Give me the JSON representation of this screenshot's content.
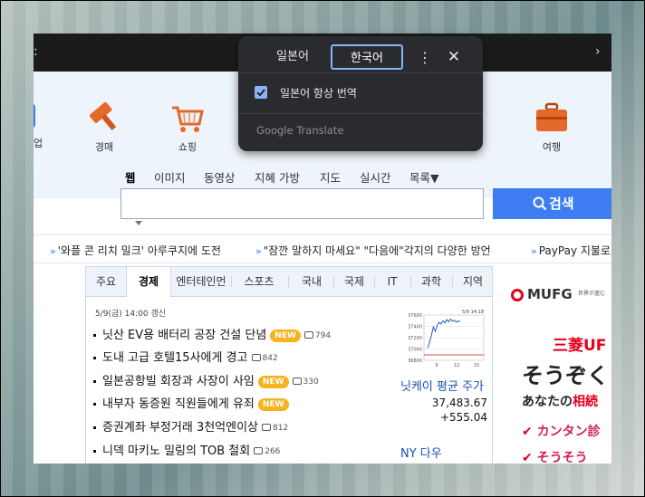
{
  "services": [
    {
      "label": "업",
      "icon": "partial-icon"
    },
    {
      "label": "경매",
      "icon": "auction-hammer-icon"
    },
    {
      "label": "쇼핑",
      "icon": "shopping-cart-icon"
    },
    {
      "label": "여행",
      "icon": "suitcase-icon"
    }
  ],
  "search": {
    "tabs": [
      "웹",
      "이미지",
      "동영상",
      "지혜 가방",
      "지도",
      "실시간",
      "목록▼"
    ],
    "active_tab": "웹",
    "button_label": "검색",
    "value": ""
  },
  "ticker": [
    "'와플 콘 리치 밀크' 아루쿠지에 도전",
    "\"잠깐 말하지 마세요\" \"다음에\"각지의 다양한 방언",
    "PayPay 지불로"
  ],
  "news": {
    "tabs": [
      "주요",
      "경제",
      "엔터테인먼",
      "스포츠",
      "국내",
      "국제",
      "IT",
      "과학",
      "지역"
    ],
    "active_tab": "경제",
    "updated": "5/9(금) 14:00 갱신",
    "headlines": [
      {
        "text": "닛산 EV용 배터리 공장 건설 단념",
        "new": "NEW",
        "comments": "794"
      },
      {
        "text": "도내 고급 호텔15사에게 경고",
        "new": "",
        "comments": "842"
      },
      {
        "text": "일본공항빌 회장과 사장이 사임",
        "new": "NEW",
        "comments": "330"
      },
      {
        "text": "내부자 동증원 직원들에게 유죄",
        "new": "NEW",
        "comments": ""
      },
      {
        "text": "증권계좌 부정거래 3천억엔이상",
        "new": "",
        "comments": "812"
      },
      {
        "text": "니덱 마키노 밀링의 TOB 철회",
        "new": "",
        "comments": "266"
      }
    ]
  },
  "stock": {
    "name": "닛케이 평균 주가",
    "value": "37,483.67",
    "change": "+555.04",
    "second": "NY 다우",
    "chart_header": "5/9 14:18",
    "chart_ticks_y": [
      "37600",
      "37400",
      "37200",
      "37000",
      "36800"
    ],
    "chart_ticks_x": [
      "9",
      "12",
      "15"
    ],
    "series": [
      37020,
      37110,
      37240,
      37390,
      37310,
      37420,
      37470,
      37440,
      37500,
      37460,
      37520,
      37480,
      37530,
      37490,
      37510,
      37470,
      37500,
      37480
    ]
  },
  "ad": {
    "brand": "MUFG",
    "tagline": "世界が進む",
    "line1": "三菱UF",
    "line2": "そうぞく",
    "line3_prefix": "あなたの",
    "line3_accent": "相続",
    "checks": [
      "カンタン診",
      "そうそう"
    ]
  },
  "translate_popup": {
    "source_lang": "일본어",
    "target_lang": "한국어",
    "always_translate_label": "일본어 항상 번역",
    "always_translate_checked": true,
    "footer": "Google Translate"
  },
  "colors": {
    "accent": "#3d7df1",
    "popup_bg": "#2a2b2e",
    "popup_accent": "#8ab4f8",
    "new_badge": "#f5b320",
    "ad_red": "#e2001a"
  }
}
